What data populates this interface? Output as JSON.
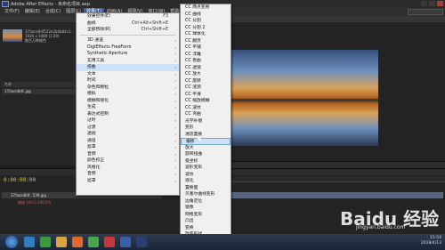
{
  "window": {
    "title": "Adobe After Effects - 未命名项目.aep"
  },
  "menubar": {
    "items": [
      "文件(F)",
      "编辑(E)",
      "合成(C)",
      "图层(L)",
      "效果(T)",
      "动画(A)",
      "视图(V)",
      "窗口(W)",
      "帮助(H)"
    ],
    "active_index": 4
  },
  "project": {
    "thumb_name": "370ace8df532e2b4b84c3...",
    "thumb_info": "1920 x 1080 (1.00)",
    "thumb_extra": "数百万种颜色",
    "list_header": "名称",
    "row": "370ace8df..jpg"
  },
  "effect_menu": {
    "items": [
      {
        "label": "效果控件(E)",
        "shortcut": "F3",
        "arrow": ""
      },
      {
        "label": "曲线",
        "shortcut": "Ctrl+Alt+Shift+E",
        "arrow": ""
      },
      {
        "label": "全部移除(R)",
        "shortcut": "Ctrl+Shift+E",
        "arrow": ""
      },
      {
        "sep": true
      },
      {
        "label": "3D 通道",
        "shortcut": "",
        "arrow": "›"
      },
      {
        "label": "DigiEffects FreeForm",
        "shortcut": "",
        "arrow": "›"
      },
      {
        "label": "Synthetic Aperture",
        "shortcut": "",
        "arrow": "›"
      },
      {
        "label": "实用工具",
        "shortcut": "",
        "arrow": "›"
      },
      {
        "label": "扭曲",
        "shortcut": "",
        "arrow": "›",
        "hl": true
      },
      {
        "label": "文本",
        "shortcut": "",
        "arrow": "›"
      },
      {
        "label": "时间",
        "shortcut": "",
        "arrow": "›"
      },
      {
        "label": "杂色和颗粒",
        "shortcut": "",
        "arrow": "›"
      },
      {
        "label": "模拟",
        "shortcut": "",
        "arrow": "›"
      },
      {
        "label": "模糊和锐化",
        "shortcut": "",
        "arrow": "›"
      },
      {
        "label": "生成",
        "shortcut": "",
        "arrow": "›"
      },
      {
        "label": "表达式控制",
        "shortcut": "",
        "arrow": "›"
      },
      {
        "label": "过时",
        "shortcut": "",
        "arrow": "›"
      },
      {
        "label": "过渡",
        "shortcut": "",
        "arrow": "›"
      },
      {
        "label": "透视",
        "shortcut": "",
        "arrow": "›"
      },
      {
        "label": "通道",
        "shortcut": "",
        "arrow": "›"
      },
      {
        "label": "遮罩",
        "shortcut": "",
        "arrow": "›"
      },
      {
        "label": "音频",
        "shortcut": "",
        "arrow": "›"
      },
      {
        "label": "颜色校正",
        "shortcut": "",
        "arrow": "›"
      },
      {
        "label": "风格化",
        "shortcut": "",
        "arrow": "›"
      },
      {
        "label": "音频",
        "shortcut": "",
        "arrow": "›"
      },
      {
        "label": "遮罩",
        "shortcut": "",
        "arrow": "›"
      }
    ]
  },
  "sub_menu": {
    "items": [
      "CC 两点变换",
      "CC 曲线",
      "CC 分割",
      "CC 分割 2",
      "CC 球体化",
      "CC 翻页",
      "CC 平铺",
      "CC 浮雕",
      "CC 卷曲",
      "CC 透镜",
      "CC 放大",
      "CC 旋转",
      "CC 涟漪",
      "CC 平滑",
      "CC 缩放模糊",
      "CC 波纹",
      "CC 弯曲",
      "光学补偿",
      "变形",
      "湍流置换",
      "偏移",
      "放大",
      "旋转扭曲",
      "极坐标",
      "波形变形",
      "波纹",
      "液化",
      "置换图",
      "贝塞尔曲线变形",
      "边角定位",
      "镜像",
      "网格变形",
      "凸出",
      "变换",
      "改变形状",
      "边角定位",
      "球面化"
    ],
    "hl_index": 20
  },
  "timeline": {
    "time": "0:00:00:00",
    "layer": "370ace8df...539.jpg",
    "sub": "缩放 100.0,100.0%"
  },
  "tray": {
    "time": "15:54",
    "date": "2018/4/13"
  },
  "watermark": {
    "main": "Baidu 经验",
    "sub": "jingyan.baidu.com"
  },
  "colors": {
    "accent": "#3b5ea8",
    "menu_bg": "#f0f0f0",
    "highlight": "#cde1f7"
  }
}
